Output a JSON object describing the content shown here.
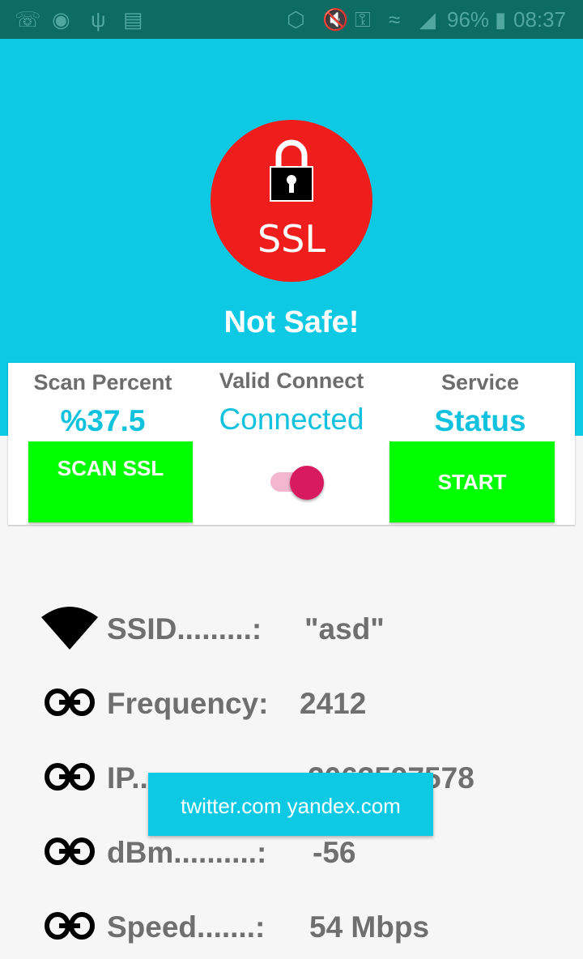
{
  "status_bar": {
    "battery": "96%",
    "time": "08:37",
    "icons": [
      "whatsapp-icon",
      "firefox-icon",
      "usb-icon",
      "android-icon",
      "circle-icon",
      "mute-icon",
      "key-icon",
      "wifi-icon",
      "signal-icon",
      "battery-icon"
    ]
  },
  "header": {
    "badge_text": "SSL",
    "status_text": "Not Safe!",
    "colors": {
      "background": "#0dc9e3",
      "badge": "#f01d1d"
    }
  },
  "panel": {
    "scan": {
      "heading": "Scan Percent",
      "value": "%37.5",
      "button": "SCAN SSL"
    },
    "connect": {
      "heading": "Valid Connect",
      "value": "Connected",
      "toggle_on": true
    },
    "service": {
      "heading": "Service",
      "value": "Status",
      "button": "START"
    },
    "colors": {
      "accent": "#10c2dd",
      "button": "#00ff00",
      "toggle": "#d81b60"
    }
  },
  "network_info": {
    "rows": [
      {
        "label": "SSID.........:",
        "value": "\"asd\"",
        "icon": "wifi-icon"
      },
      {
        "label": "Frequency:",
        "value": "2412",
        "icon": "link-icon"
      },
      {
        "label": "IP...............:",
        "value": "2063597578",
        "icon": "link-icon"
      },
      {
        "label": "dBm..........:",
        "value": "-56",
        "icon": "link-icon"
      },
      {
        "label": "Speed.......:",
        "value": "54 Mbps",
        "icon": "link-icon"
      }
    ]
  },
  "toast": {
    "text": "twitter.com yandex.com"
  }
}
